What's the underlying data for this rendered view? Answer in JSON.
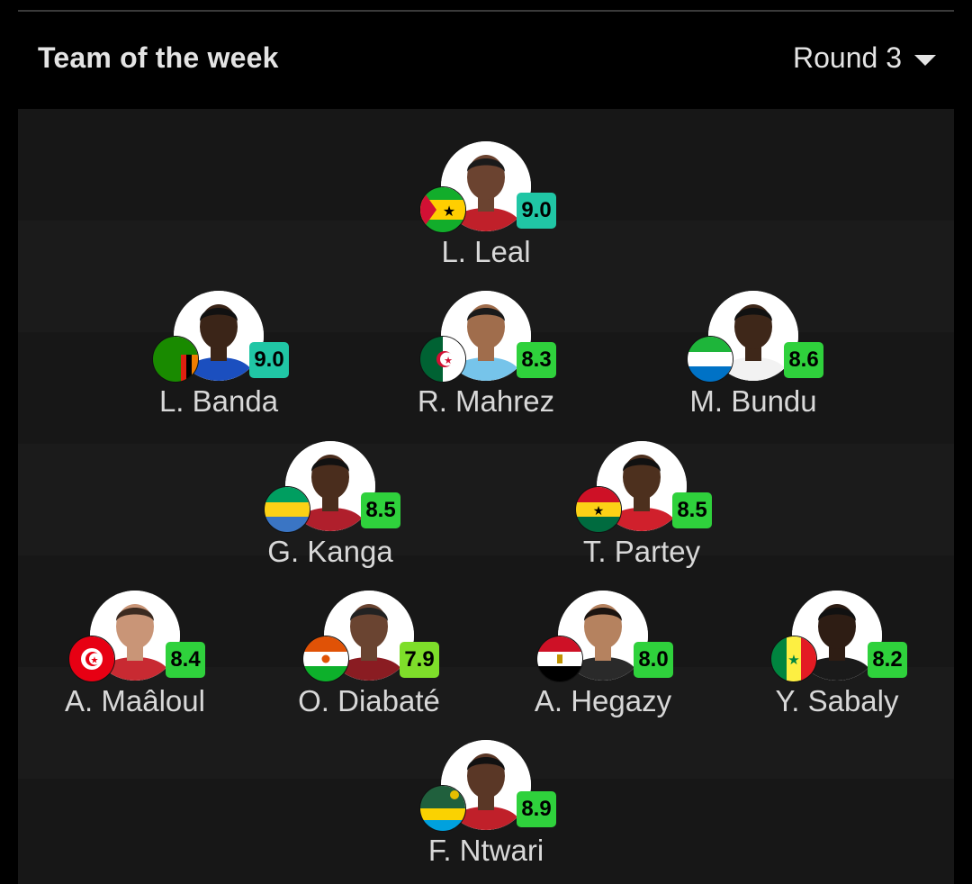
{
  "header": {
    "title": "Team of the week",
    "round_label": "Round 3"
  },
  "colors": {
    "rating_teal": "#20c6a5",
    "rating_green": "#2fd13c",
    "rating_lime": "#7ede2a",
    "background": "#000000",
    "pitch": "#171717"
  },
  "players": [
    {
      "name": "L. Leal",
      "rating": "9.0",
      "flag": "sao-tome-flag-icon",
      "rating_color": "#20c6a5",
      "skin": "#6b4330",
      "shirt": "#c0202a",
      "hair": "#1a1a1a"
    },
    {
      "name": "L. Banda",
      "rating": "9.0",
      "flag": "zambia-flag-icon",
      "rating_color": "#20c6a5",
      "skin": "#3b2518",
      "shirt": "#1b4fbf",
      "hair": "#111111"
    },
    {
      "name": "R. Mahrez",
      "rating": "8.3",
      "flag": "algeria-flag-icon",
      "rating_color": "#2fd13c",
      "skin": "#a06d4c",
      "shirt": "#76c4ea",
      "hair": "#1a1a1a"
    },
    {
      "name": "M. Bundu",
      "rating": "8.6",
      "flag": "sierra-leone-flag-icon",
      "rating_color": "#2fd13c",
      "skin": "#3e2719",
      "shirt": "#f2f2f2",
      "hair": "#111111"
    },
    {
      "name": "G. Kanga",
      "rating": "8.5",
      "flag": "gabon-flag-icon",
      "rating_color": "#2fd13c",
      "skin": "#4a2d1d",
      "shirt": "#b01f2c",
      "hair": "#111111"
    },
    {
      "name": "T. Partey",
      "rating": "8.5",
      "flag": "ghana-flag-icon",
      "rating_color": "#2fd13c",
      "skin": "#4d301e",
      "shirt": "#d0202c",
      "hair": "#111111"
    },
    {
      "name": "A. Maâloul",
      "rating": "8.4",
      "flag": "tunisia-flag-icon",
      "rating_color": "#2fd13c",
      "skin": "#c99577",
      "shirt": "#c82a32",
      "hair": "#3b2a20"
    },
    {
      "name": "O. Diabaté",
      "rating": "7.9",
      "flag": "niger-flag-icon",
      "rating_color": "#7ede2a",
      "skin": "#6a4431",
      "shirt": "#8a1c22",
      "hair": "#222222"
    },
    {
      "name": "A. Hegazy",
      "rating": "8.0",
      "flag": "egypt-flag-icon",
      "rating_color": "#2fd13c",
      "skin": "#b5825f",
      "shirt": "#2a2a2a",
      "hair": "#1b1410"
    },
    {
      "name": "Y. Sabaly",
      "rating": "8.2",
      "flag": "senegal-flag-icon",
      "rating_color": "#2fd13c",
      "skin": "#2e1d14",
      "shirt": "#1a1a1a",
      "hair": "#111111"
    },
    {
      "name": "F. Ntwari",
      "rating": "8.9",
      "flag": "rwanda-flag-icon",
      "rating_color": "#2fd13c",
      "skin": "#5a3726",
      "shirt": "#c0202a",
      "hair": "#111111"
    }
  ]
}
